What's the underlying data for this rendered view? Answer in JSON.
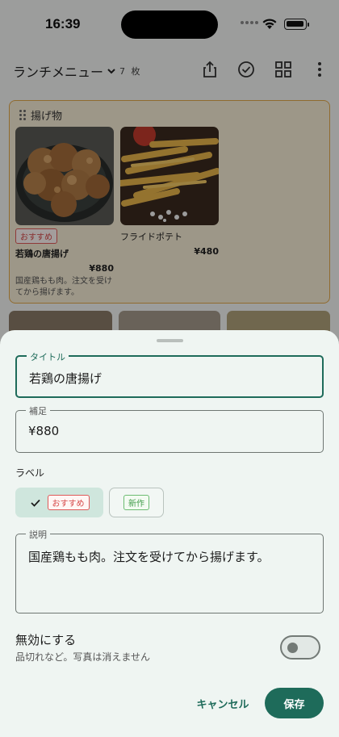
{
  "status": {
    "time": "16:39"
  },
  "menu": {
    "title": "ランチメニュー",
    "count": "7 枚",
    "group": {
      "name": "揚げ物",
      "items": [
        {
          "badge": "おすすめ",
          "name": "若鶏の唐揚げ",
          "price": "¥880",
          "description": "国産鶏もも肉。注文を受けてから揚げます。"
        },
        {
          "name": "フライドポテト",
          "price": "¥480"
        }
      ]
    }
  },
  "sheet": {
    "title_label": "タイトル",
    "title_value": "若鶏の唐揚げ",
    "note_label": "補足",
    "note_value": "¥880",
    "labels_heading": "ラベル",
    "chips": [
      {
        "label": "おすすめ",
        "selected": true,
        "color": "#d64848"
      },
      {
        "label": "新作",
        "selected": false,
        "color": "#3f9b48"
      }
    ],
    "description_label": "説明",
    "description_value": "国産鶏もも肉。注文を受けてから揚げます。",
    "disable_title": "無効にする",
    "disable_subtitle": "品切れなど。写真は消えません",
    "disable_enabled": false,
    "cancel_label": "キャンセル",
    "save_label": "保存"
  },
  "colors": {
    "accent": "#1e6b5a",
    "group_border": "#e2a84a",
    "sheet_bg": "#eff5f2"
  }
}
